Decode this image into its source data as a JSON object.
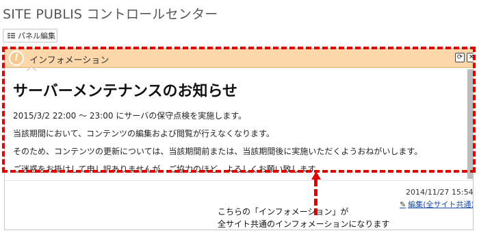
{
  "header": {
    "title": "SITE PUBLIS コントロールセンター",
    "panel_edit_label": "パネル編集"
  },
  "widget": {
    "title": "インフォメーション",
    "info_icon": "info-icon",
    "refresh_icon": "refresh-icon",
    "close_icon": "close-icon",
    "headline": "サーバーメンテナンスのお知らせ",
    "messages": [
      "2015/3/2 22:00 〜 23:00 にサーバの保守点検を実施します。",
      "当該期間において、コンテンツの編集および閲覧が行えなくなります。",
      "そのため、コンテンツの更新については、当該期間前または、当該期間後に実施いただくようおねがいします。",
      "ご迷惑をお掛けして申し訳ありませんが、ご協力のほど、よろしくお願い致します。"
    ],
    "timestamp": "2014/11/27 15:54",
    "edit_link": "編集(全サイト共通)",
    "edit_icon": "pencil-icon"
  },
  "annotation": {
    "line1": "こちらの「インフォメーション」が",
    "line2": "全サイト共通のインフォメーションになります",
    "color": "#e00000"
  },
  "colors": {
    "header_bg": "#fbd7a9",
    "link": "#1a4aa8"
  }
}
